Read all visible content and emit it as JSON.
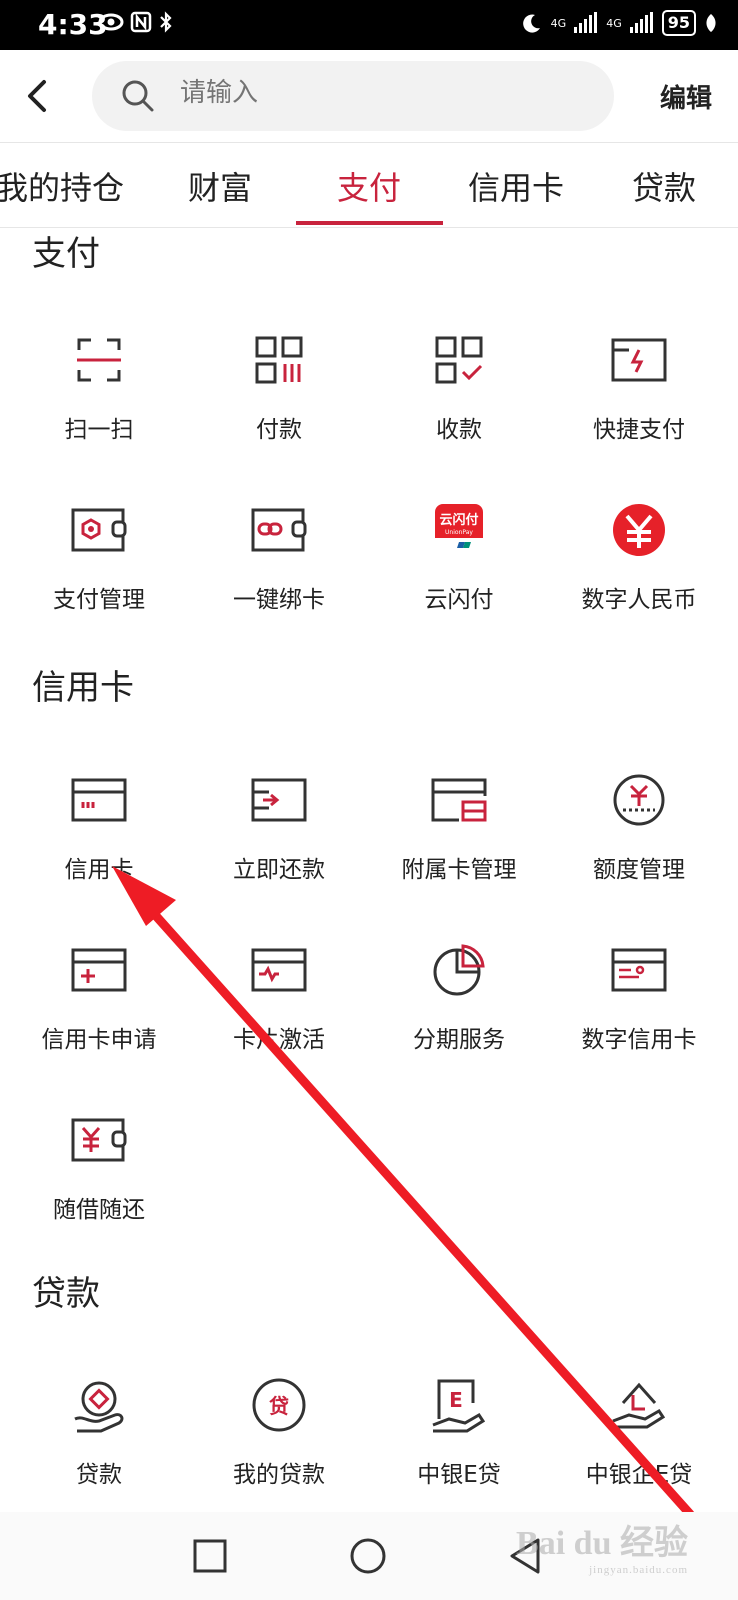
{
  "status_bar": {
    "time": "4:33",
    "network1": "4G",
    "network2": "4G",
    "battery": "95"
  },
  "header": {
    "search_placeholder": "请输入",
    "edit_label": "编辑"
  },
  "tabs": [
    "我的持仓",
    "财富",
    "支付",
    "信用卡",
    "贷款"
  ],
  "active_tab": "支付",
  "sections": {
    "payment": {
      "title": "支付",
      "items": [
        {
          "label": "扫一扫",
          "icon": "scan-icon"
        },
        {
          "label": "付款",
          "icon": "pay-code-icon"
        },
        {
          "label": "收款",
          "icon": "receive-icon"
        },
        {
          "label": "快捷支付",
          "icon": "quick-pay-icon"
        },
        {
          "label": "支付管理",
          "icon": "payment-manage-icon"
        },
        {
          "label": "一键绑卡",
          "icon": "bind-card-icon"
        },
        {
          "label": "云闪付",
          "icon": "unionpay-icon",
          "icon_text": "云闪付",
          "icon_subtext": "UnionPay"
        },
        {
          "label": "数字人民币",
          "icon": "digital-rmb-icon"
        }
      ]
    },
    "credit_card": {
      "title": "信用卡",
      "items": [
        {
          "label": "信用卡",
          "icon": "credit-card-icon"
        },
        {
          "label": "立即还款",
          "icon": "repay-icon"
        },
        {
          "label": "附属卡管理",
          "icon": "supplementary-card-icon"
        },
        {
          "label": "额度管理",
          "icon": "limit-manage-icon"
        },
        {
          "label": "信用卡申请",
          "icon": "card-apply-icon"
        },
        {
          "label": "卡片激活",
          "icon": "card-activate-icon"
        },
        {
          "label": "分期服务",
          "icon": "installment-icon"
        },
        {
          "label": "数字信用卡",
          "icon": "digital-card-icon"
        },
        {
          "label": "随借随还",
          "icon": "borrow-repay-icon"
        }
      ]
    },
    "loan": {
      "title": "贷款",
      "items": [
        {
          "label": "贷款",
          "icon": "loan-icon"
        },
        {
          "label": "我的贷款",
          "icon": "my-loan-icon",
          "icon_text": "贷"
        },
        {
          "label": "中银E贷",
          "icon": "e-loan-icon",
          "icon_text": "E"
        },
        {
          "label": "中银企E贷",
          "icon": "enterprise-loan-icon"
        }
      ]
    }
  },
  "watermark": {
    "text": "Bai du 经验",
    "subtext": "jingyan.baidu.com"
  },
  "colors": {
    "accent": "#c8233d",
    "annotation": "#ee1c25"
  }
}
